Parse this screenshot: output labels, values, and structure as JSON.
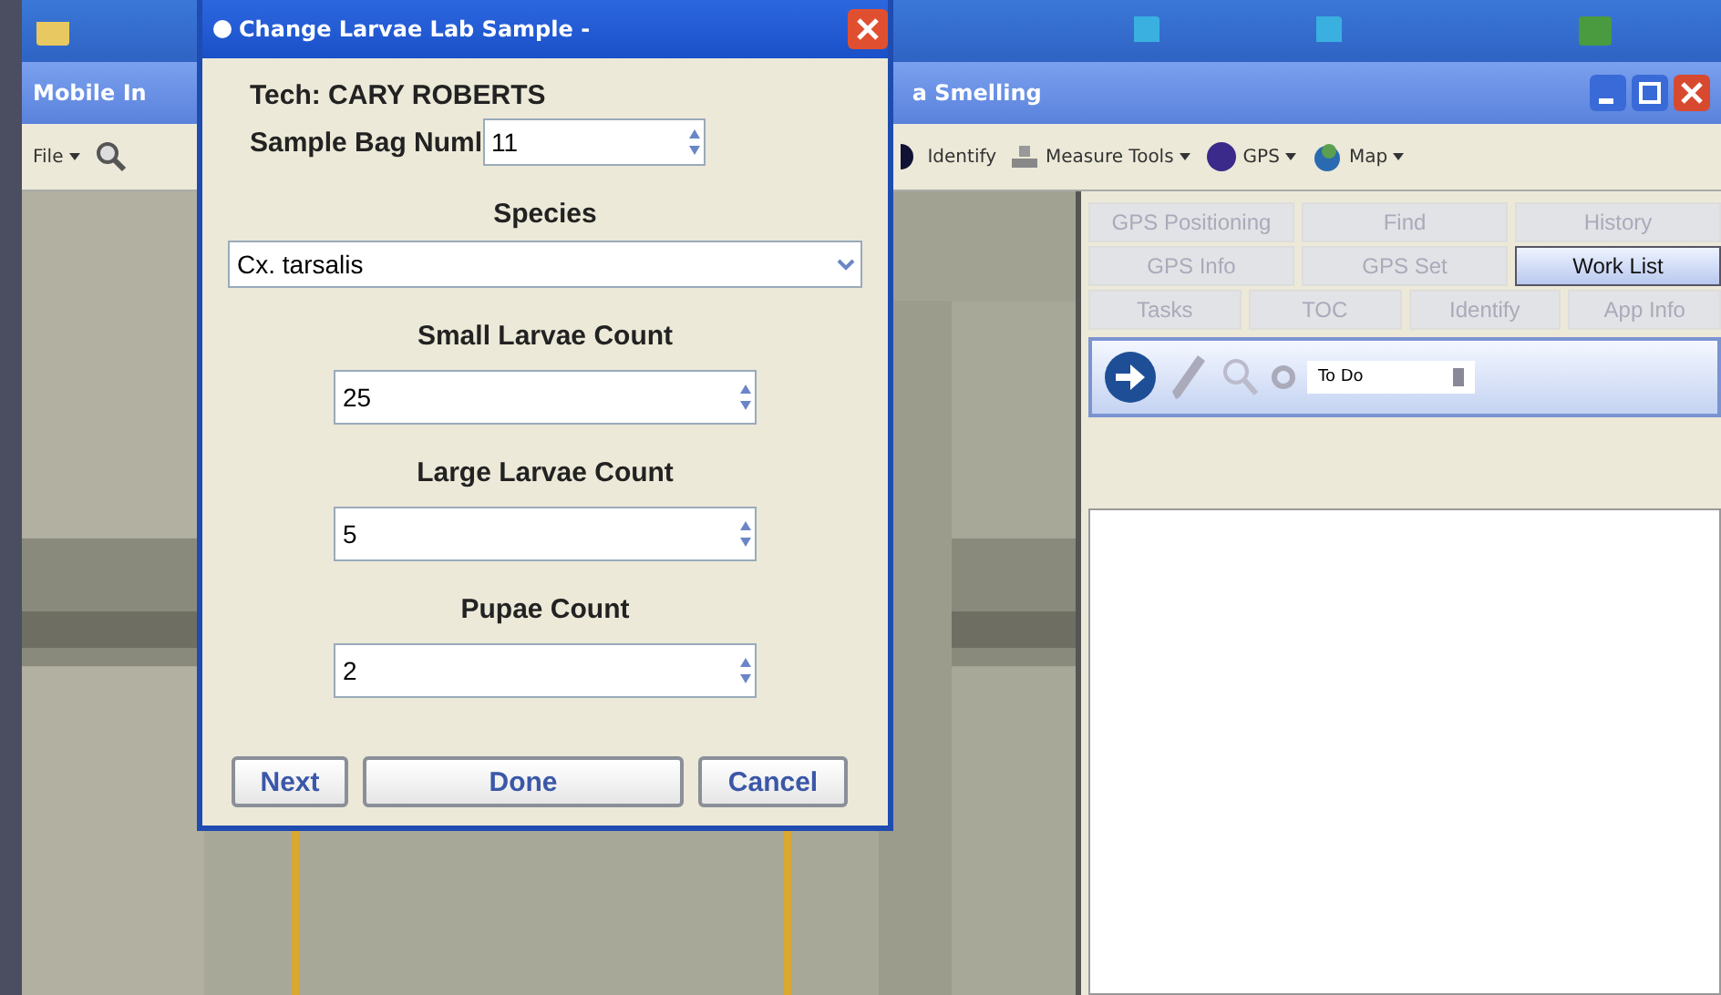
{
  "main_window": {
    "title_left": "Mobile In",
    "title_right": "a Smelling"
  },
  "toolbar": [
    {
      "kind": "menu",
      "label": "File"
    },
    {
      "kind": "zoom"
    },
    {
      "kind": "identify",
      "label": "Identify"
    },
    {
      "kind": "measure",
      "label": "Measure Tools"
    },
    {
      "kind": "gps",
      "label": "GPS"
    },
    {
      "kind": "map",
      "label": "Map"
    }
  ],
  "side_panel": {
    "tab_rows": [
      [
        {
          "label": "GPS Positioning",
          "selected": false
        },
        {
          "label": "Find",
          "selected": false
        },
        {
          "label": "History",
          "selected": false
        }
      ],
      [
        {
          "label": "GPS Info",
          "selected": false
        },
        {
          "label": "GPS Set",
          "selected": false
        },
        {
          "label": "Work List",
          "selected": true
        }
      ],
      [
        {
          "label": "Tasks",
          "selected": false
        },
        {
          "label": "TOC",
          "selected": false
        },
        {
          "label": "Identify",
          "selected": false
        },
        {
          "label": "App Info",
          "selected": false
        }
      ]
    ],
    "filter": "To Do"
  },
  "dialog": {
    "title": "Change Larvae Lab Sample -",
    "tech": "Tech: CARY ROBERTS",
    "bag_label": "Sample Bag Numl",
    "bag_value": "11",
    "species_label": "Species",
    "species_value": "Cx. tarsalis",
    "counts": [
      {
        "label": "Small Larvae Count",
        "value": "25"
      },
      {
        "label": "Large Larvae Count",
        "value": "5"
      },
      {
        "label": "Pupae Count",
        "value": "2"
      }
    ],
    "buttons": [
      "Next",
      "Done",
      "Cancel"
    ]
  }
}
